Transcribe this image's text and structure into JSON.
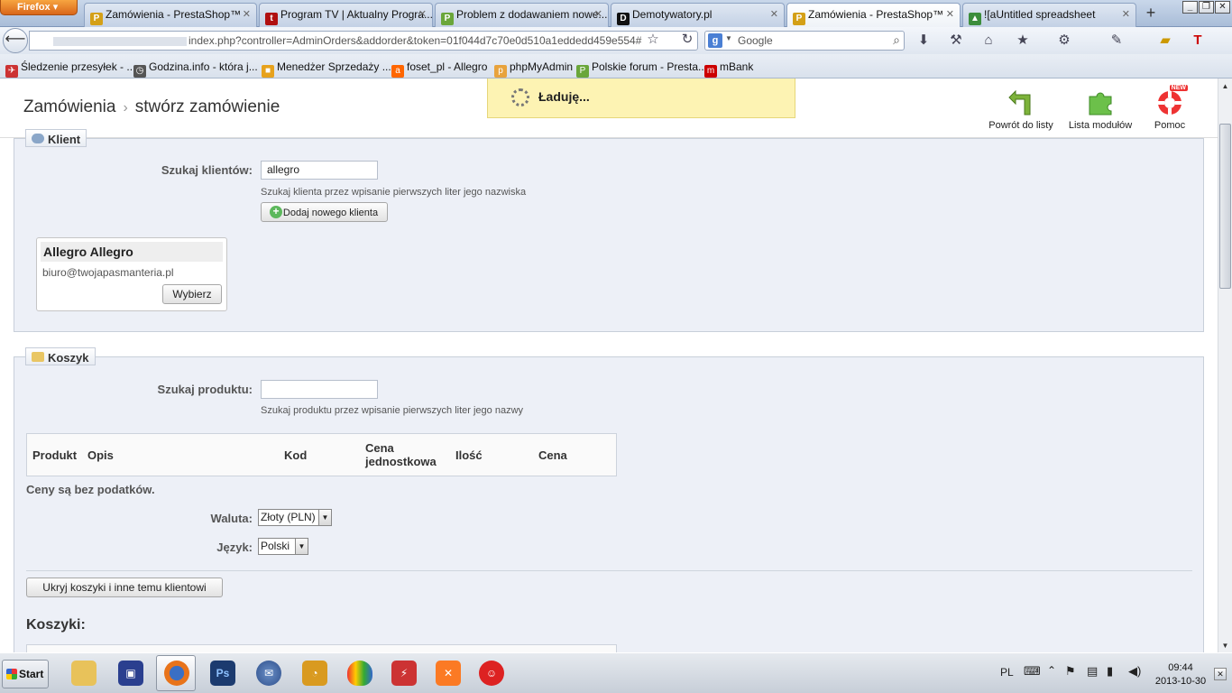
{
  "browser": {
    "menu_button": "Firefox",
    "tabs": [
      {
        "title": "Zamówienia - PrestaShop™",
        "icon": "prestashop-icon"
      },
      {
        "title": "Program TV | Aktualny Progra...",
        "icon": "tv-icon"
      },
      {
        "title": "Problem z dodawaniem nowe...",
        "icon": "forum-icon"
      },
      {
        "title": "Demotywatory.pl",
        "icon": "d-icon"
      },
      {
        "title": "Zamówienia - PrestaShop™",
        "icon": "prestashop-icon"
      },
      {
        "title": "![aUntitled spreadsheet",
        "icon": "drive-icon"
      }
    ],
    "url": "index.php?controller=AdminOrders&addorder&token=01f044d7c70e0d510a1eddedd459e554#",
    "search_placeholder": "Google",
    "bookmarks": [
      {
        "label": "Śledzenie przesyłek - ..."
      },
      {
        "label": "Godzina.info - która j..."
      },
      {
        "label": "Menedżer Sprzedaży ..."
      },
      {
        "label": "foset_pl - Allegro"
      },
      {
        "label": "phpMyAdmin"
      },
      {
        "label": "Polskie forum - Presta..."
      },
      {
        "label": "mBank"
      }
    ]
  },
  "header": {
    "breadcrumb_parent": "Zamówienia",
    "breadcrumb_current": "stwórz zamówienie",
    "loading_text": "Ładuję...",
    "toolbar": {
      "back_label": "Powrót do listy",
      "modules_label": "Lista modułów",
      "help_label": "Pomoc",
      "help_badge": "NEW"
    }
  },
  "client_section": {
    "legend": "Klient",
    "search_label": "Szukaj klientów:",
    "search_value": "allegro",
    "search_hint": "Szukaj klienta przez wpisanie pierwszych liter jego nazwiska",
    "add_button": "Dodaj nowego klienta",
    "result": {
      "name": "Allegro Allegro",
      "email": "biuro@twojapasmanteria.pl",
      "choose_button": "Wybierz"
    }
  },
  "cart_section": {
    "legend": "Koszyk",
    "search_label": "Szukaj produktu:",
    "search_value": "",
    "search_hint": "Szukaj produktu przez wpisanie pierwszych liter jego nazwy",
    "table_headers": [
      "Produkt",
      "Opis",
      "Kod",
      "Cena jednostkowa",
      "Ilość",
      "Cena"
    ],
    "tax_note": "Ceny są bez podatków.",
    "currency_label": "Waluta:",
    "currency_value": "Złoty (PLN)",
    "language_label": "Język:",
    "language_value": "Polski",
    "hide_button": "Ukryj koszyki i inne temu klientowi",
    "carts_title": "Koszyki:"
  },
  "taskbar": {
    "start_label": "Start",
    "language": "PL",
    "time": "09:44",
    "date": "2013-10-30"
  }
}
